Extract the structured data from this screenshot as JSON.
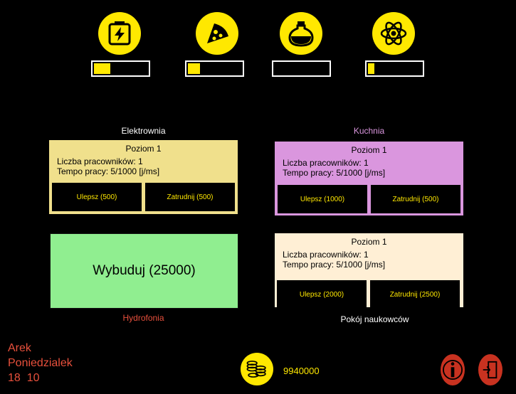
{
  "resources": [
    {
      "icon": "lightning-battery-icon",
      "level": 0.3
    },
    {
      "icon": "pizza-icon",
      "level": 0.23
    },
    {
      "icon": "flask-icon",
      "level": 0.0
    },
    {
      "icon": "atom-icon",
      "level": 0.12
    }
  ],
  "rooms": {
    "power_plant": {
      "title": "Elektrownia",
      "level": "Poziom 1",
      "workers": "Liczba pracowników: 1",
      "rate": "Tempo pracy: 5/1000 [j/ms]",
      "upgrade": "Ulepsz (500)",
      "hire": "Zatrudnij (500)",
      "color": "#F0E08C"
    },
    "kitchen": {
      "title": "Kuchnia",
      "level": "Poziom 1",
      "workers": "Liczba pracowników: 1",
      "rate": "Tempo pracy: 5/1000 [j/ms]",
      "upgrade": "Ulepsz (1000)",
      "hire": "Zatrudnij (500)",
      "color": "#DA96DE"
    },
    "hydroponics": {
      "title": "Hydrofonia",
      "build": "Wybuduj (25000)",
      "color": "#90EE90"
    },
    "science_room": {
      "title": "Pokój naukowców",
      "level": "Poziom 1",
      "workers": "Liczba pracowników: 1",
      "rate": "Tempo pracy: 5/1000 [j/ms]",
      "upgrade": "Ulepsz (2000)",
      "hire": "Zatrudnij (2500)",
      "color": "#FFEFD5"
    }
  },
  "player": {
    "name": "Arek",
    "day": "Poniedzialek",
    "time": "18  10"
  },
  "money": {
    "amount": "9940000",
    "icon": "coins-icon"
  },
  "buttons": {
    "info_icon": "info-icon",
    "exit_icon": "exit-door-icon"
  },
  "colors": {
    "accent": "#FFE800",
    "player_text": "#E8503C",
    "kitchen_title": "#DA96DE",
    "hydro_title": "#E8503C"
  }
}
